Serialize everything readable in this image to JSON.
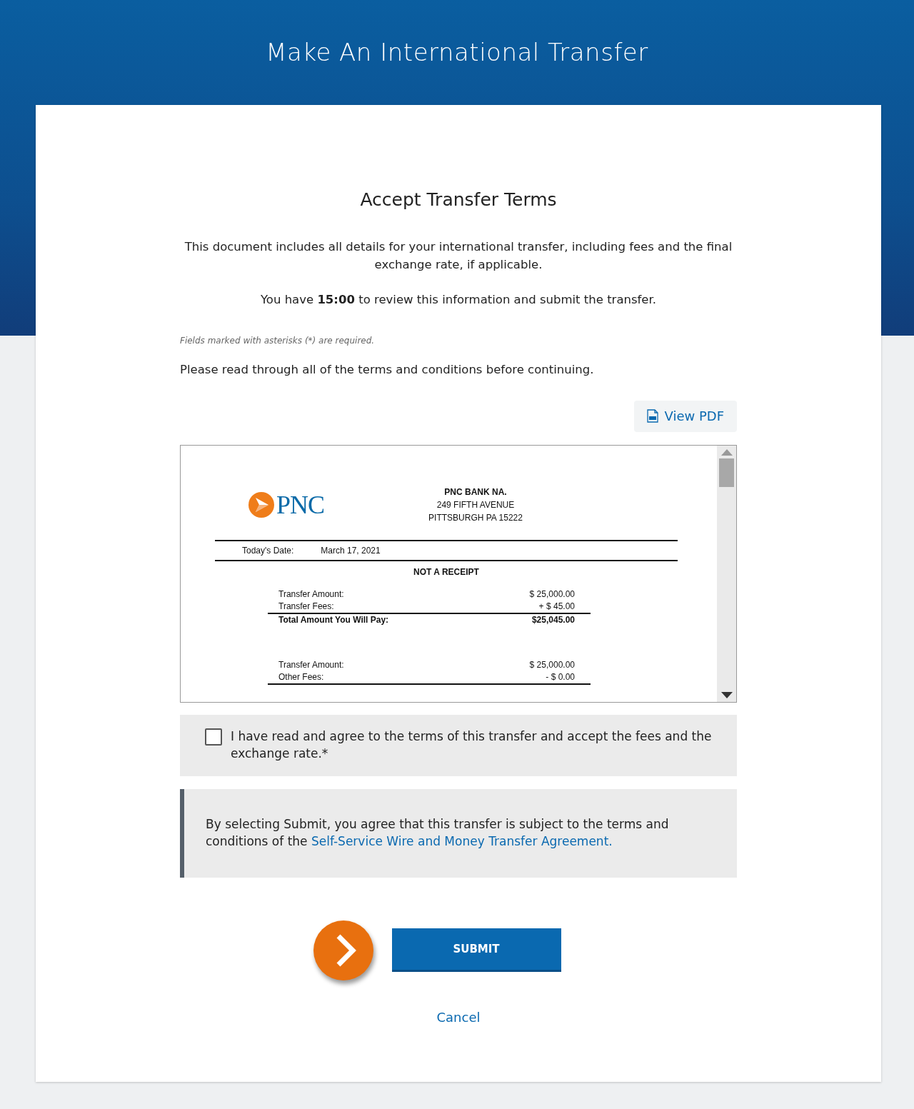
{
  "page_title": "Make An International Transfer",
  "heading": "Accept Transfer Terms",
  "intro": "This document includes all details for your international transfer, including fees and the final exchange rate, if applicable.",
  "timer_text": "You have **15:00** to review this information and submit the transfer.",
  "required_note": "Fields marked with asterisks (*) are required.",
  "read_note": "Please read through all of the terms and conditions before continuing.",
  "view_pdf": "View PDF",
  "document": {
    "logo_text": "PNC",
    "bank_name": "PNC BANK NA.",
    "address_lines": [
      "249 FIFTH AVENUE",
      "PITTSBURGH PA 15222"
    ],
    "date_label": "Today's Date:",
    "date_value": "March 17, 2021",
    "notice": "NOT A RECEIPT",
    "sections": [
      {
        "rows": [
          {
            "label": "Transfer Amount:",
            "value": "$ 25,000.00"
          },
          {
            "label": "Transfer Fees:",
            "value": "+ $ 45.00"
          }
        ],
        "total": {
          "label": "Total Amount You Will Pay:",
          "value": "$25,045.00"
        }
      },
      {
        "rows": [
          {
            "label": "Transfer Amount:",
            "value": "$ 25,000.00"
          },
          {
            "label": "Other Fees:",
            "value": "- $ 0.00"
          }
        ]
      }
    ]
  },
  "agree": {
    "label": "I have read and agree to the terms of this transfer and accept the fees and the exchange rate.*",
    "checked": false
  },
  "disclaimer": {
    "text": "By selecting Submit, you agree that this transfer is subject to the terms and conditions of the",
    "link": "Self-Service Wire and Money Transfer Agreement."
  },
  "submit": "SUBMIT",
  "cancel": "Cancel"
}
